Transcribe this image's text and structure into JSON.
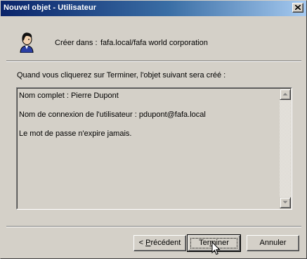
{
  "window": {
    "title": "Nouvel objet - Utilisateur"
  },
  "header": {
    "create_in_label": "Créer dans :",
    "create_in_value": "fafa.local/fafa world corporation"
  },
  "summary": {
    "heading": "Quand vous cliquerez sur Terminer, l'objet suivant sera créé :",
    "lines": [
      "Nom complet : Pierre Dupont",
      "Nom de connexion de l'utilisateur : pdupont@fafa.local",
      "Le mot de passe n'expire jamais."
    ]
  },
  "buttons": {
    "previous_prefix": "< ",
    "previous_accel": "P",
    "previous_rest": "récédent",
    "finish_pre": "Ter",
    "finish_accel": "m",
    "finish_post": "iner",
    "cancel": "Annuler"
  },
  "colors": {
    "titlebar_start": "#0a246a",
    "titlebar_end": "#a6caf0",
    "face": "#d4d0c8",
    "shadow": "#808080",
    "highlight": "#ffffff"
  },
  "icons": {
    "user": "user-icon",
    "close": "close-icon",
    "scroll_up": "arrow-up-icon",
    "scroll_down": "arrow-down-icon",
    "cursor": "mouse-pointer-icon"
  }
}
